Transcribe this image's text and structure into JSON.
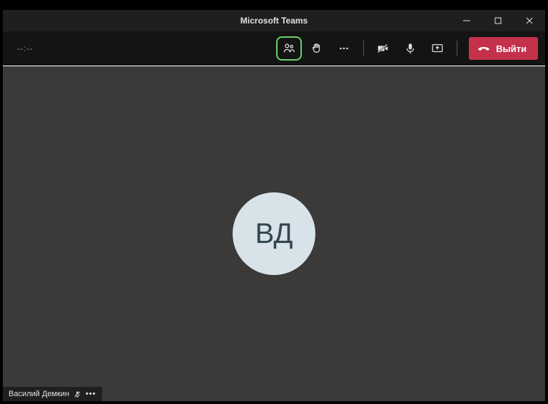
{
  "window": {
    "title": "Microsoft Teams"
  },
  "toolbar": {
    "timer": "--:--",
    "leave_label": "Выйти"
  },
  "participant": {
    "initials": "ВД",
    "name": "Василий Демкин"
  }
}
